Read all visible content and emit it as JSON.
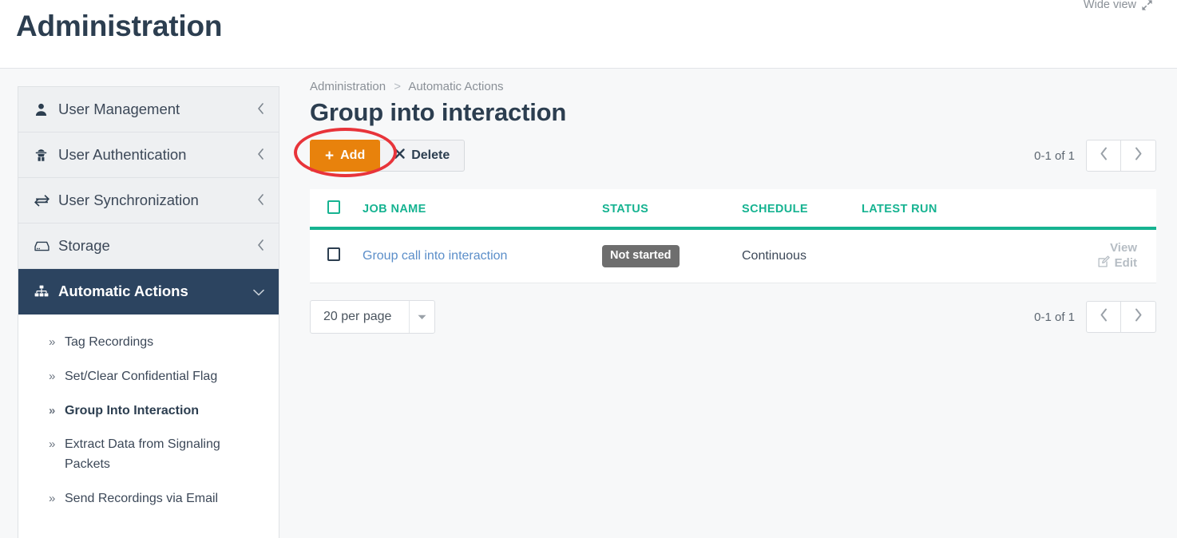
{
  "header": {
    "title": "Administration",
    "wide_view_label": "Wide view",
    "wide_view_icon": "expand-arrows-icon"
  },
  "sidebar": {
    "items": [
      {
        "label": "User Management",
        "icon": "user-icon",
        "chevron": "chevron-left-icon",
        "active": false
      },
      {
        "label": "User Authentication",
        "icon": "user-secret-icon",
        "chevron": "chevron-left-icon",
        "active": false
      },
      {
        "label": "User Synchronization",
        "icon": "exchange-arrows-icon",
        "chevron": "chevron-left-icon",
        "active": false
      },
      {
        "label": "Storage",
        "icon": "hdd-icon",
        "chevron": "chevron-left-icon",
        "active": false
      },
      {
        "label": "Automatic Actions",
        "icon": "sitemap-icon",
        "chevron": "chevron-down-icon",
        "active": true
      }
    ],
    "subitems": [
      {
        "label": "Tag Recordings",
        "current": false
      },
      {
        "label": "Set/Clear Confidential Flag",
        "current": false
      },
      {
        "label": "Group Into Interaction",
        "current": true
      },
      {
        "label": "Extract Data from Signaling Packets",
        "current": false
      },
      {
        "label": "Send Recordings via Email",
        "current": false
      }
    ]
  },
  "main": {
    "breadcrumb": {
      "root": "Administration",
      "separator": ">",
      "current": "Automatic Actions"
    },
    "title": "Group into interaction",
    "toolbar": {
      "add_label": "Add",
      "add_icon": "plus-icon",
      "delete_label": "Delete",
      "delete_icon": "times-icon"
    },
    "pager_top": {
      "count": "0-1 of 1",
      "prev_icon": "chevron-left-icon",
      "next_icon": "chevron-right-icon"
    },
    "pager_bottom": {
      "count": "0-1 of 1",
      "prev_icon": "chevron-left-icon",
      "next_icon": "chevron-right-icon"
    },
    "per_page": {
      "value": "20 per page",
      "caret_icon": "caret-down-icon"
    },
    "table": {
      "columns": [
        "JOB NAME",
        "STATUS",
        "SCHEDULE",
        "LATEST RUN"
      ],
      "rows": [
        {
          "name": "Group call into interaction",
          "status": "Not started",
          "schedule": "Continuous",
          "latest_run": "",
          "view_label": "View",
          "edit_label": "Edit",
          "edit_icon": "pencil-square-icon"
        }
      ]
    }
  },
  "annotation": {
    "shape": "red-ellipse",
    "color": "#e8343a",
    "target": "add-button"
  },
  "colors": {
    "accent_teal": "#16b391",
    "add_orange": "#e8820c",
    "sidebar_active": "#2c4460",
    "link_blue": "#5b8ec9",
    "badge_gray": "#6e6e6e",
    "annotation_red": "#e8343a"
  }
}
